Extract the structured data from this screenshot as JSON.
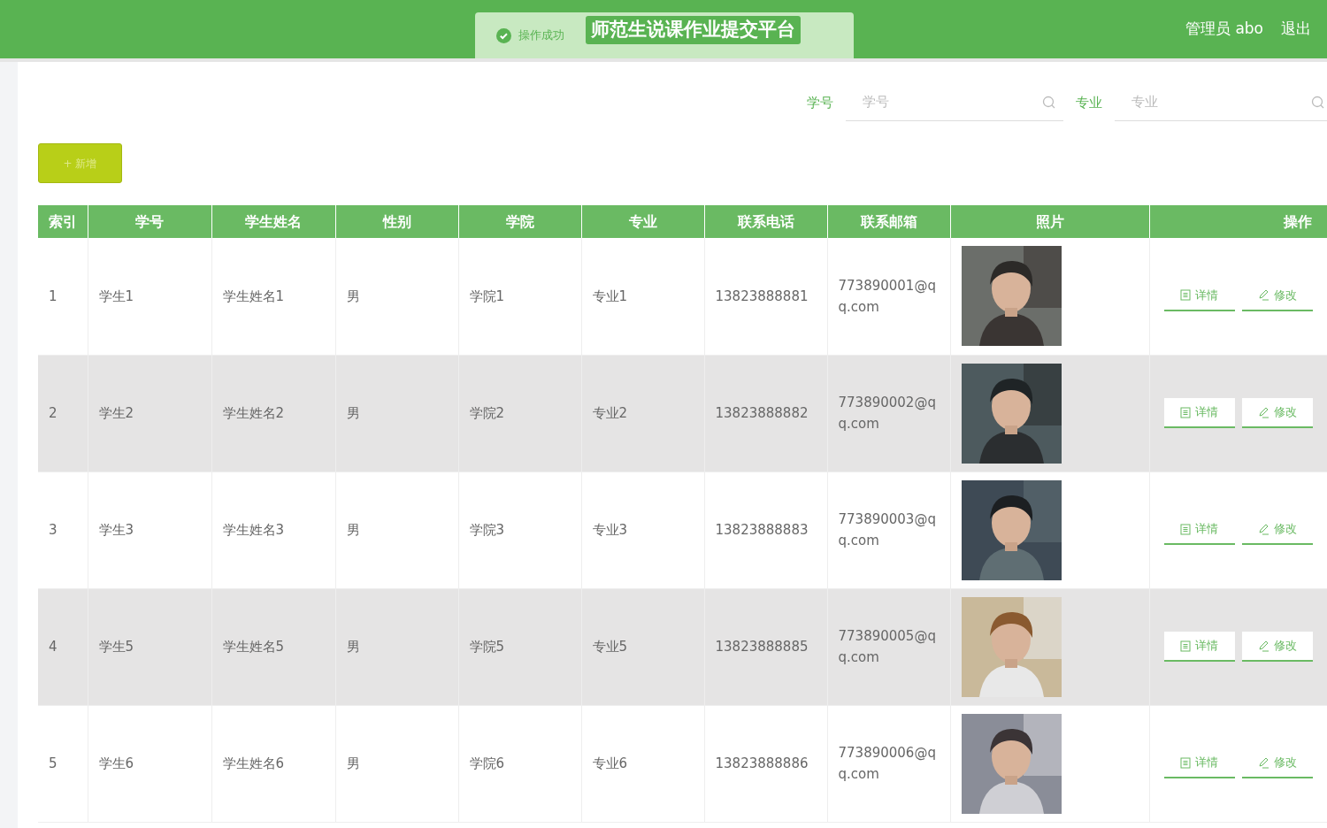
{
  "header": {
    "title": "师范生说课作业提交平台",
    "user": "管理员 abo",
    "logout": "退出"
  },
  "toast": {
    "kind": "success",
    "text": "操作成功"
  },
  "search_fields": [
    {
      "label": "学号",
      "placeholder": "学号"
    },
    {
      "label": "专业",
      "placeholder": "专业"
    }
  ],
  "add_button": {
    "label": "+ 新增"
  },
  "table": {
    "columns": [
      "索引",
      "学号",
      "学生姓名",
      "性别",
      "学院",
      "专业",
      "联系电话",
      "联系邮箱",
      "照片",
      "操作"
    ],
    "rows": [
      {
        "cells": [
          "1",
          "学生1",
          "学生姓名1",
          "男",
          "学院1",
          "专业1",
          "13823888881",
          "773890001@qq.com"
        ],
        "actions": [
          "详情",
          "修改"
        ]
      },
      {
        "cells": [
          "2",
          "学生2",
          "学生姓名2",
          "男",
          "学院2",
          "专业2",
          "13823888882",
          "773890002@qq.com"
        ],
        "actions": [
          "详情",
          "修改"
        ]
      },
      {
        "cells": [
          "3",
          "学生3",
          "学生姓名3",
          "男",
          "学院3",
          "专业3",
          "13823888883",
          "773890003@qq.com"
        ],
        "actions": [
          "详情",
          "修改"
        ]
      },
      {
        "cells": [
          "4",
          "学生5",
          "学生姓名5",
          "男",
          "学院5",
          "专业5",
          "13823888885",
          "773890005@qq.com"
        ],
        "actions": [
          "详情",
          "修改"
        ]
      },
      {
        "cells": [
          "5",
          "学生6",
          "学生姓名6",
          "男",
          "学院6",
          "专业6",
          "13823888886",
          "773890006@qq.com"
        ],
        "actions": [
          "详情",
          "修改"
        ]
      }
    ]
  }
}
